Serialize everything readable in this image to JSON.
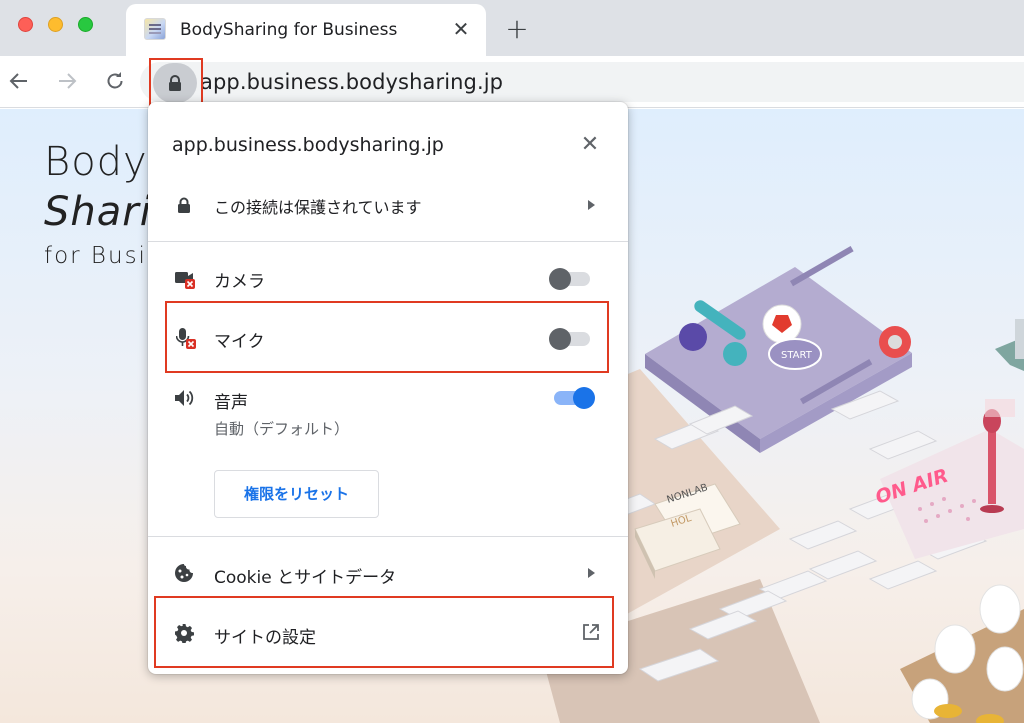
{
  "browser": {
    "tab": {
      "title": "BodySharing for Business",
      "close_icon": "close-icon"
    },
    "new_tab_icon": "plus-icon",
    "nav": {
      "back_icon": "arrow-left-icon",
      "forward_icon": "arrow-right-icon",
      "reload_icon": "reload-icon"
    },
    "address": {
      "url": "app.business.bodysharing.jp",
      "lock_icon": "lock-icon"
    }
  },
  "page": {
    "logo": {
      "line1": "Body",
      "line2": "Sharing",
      "line3": "for Business"
    },
    "scene_labels": {
      "start": "START",
      "on_air": "ON AIR",
      "nonlab": "NONLAB",
      "hol": "HOL"
    }
  },
  "popup": {
    "title": "app.business.bodysharing.jp",
    "connection": {
      "label": "この接続は保護されています",
      "icon": "lock-icon"
    },
    "permissions": [
      {
        "key": "camera",
        "label": "カメラ",
        "icon": "camera-blocked-icon",
        "enabled": false
      },
      {
        "key": "mic",
        "label": "マイク",
        "icon": "mic-blocked-icon",
        "enabled": false
      },
      {
        "key": "sound",
        "label": "音声",
        "sublabel": "自動（デフォルト）",
        "icon": "speaker-icon",
        "enabled": true
      }
    ],
    "reset_button": "権限をリセット",
    "cookies": {
      "label": "Cookie とサイトデータ",
      "icon": "cookie-icon"
    },
    "site_settings": {
      "label": "サイトの設定",
      "icon": "gear-icon",
      "trailing_icon": "external-link-icon"
    }
  },
  "colors": {
    "highlight": "#e03a21",
    "accent": "#1a73e8",
    "toggle_on_track": "#8ab4f8"
  }
}
